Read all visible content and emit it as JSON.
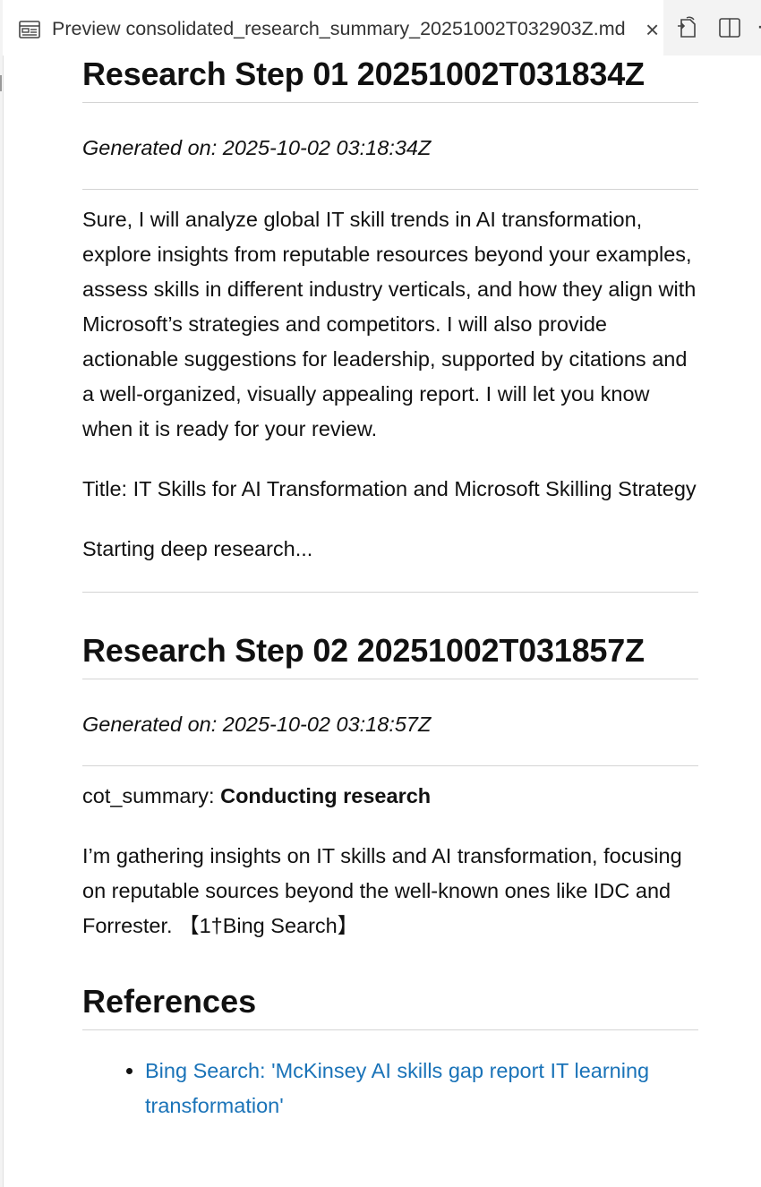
{
  "tab": {
    "title": "Preview consolidated_research_summary_20251002T032903Z.md",
    "close_glyph": "×",
    "more_glyph": "·",
    "icons": [
      "preview-icon",
      "close-icon",
      "open-source-icon",
      "split-editor-icon",
      "more-actions-icon"
    ]
  },
  "steps": [
    {
      "heading": "Research Step 01 20251002T031834Z",
      "generated": "Generated on: 2025-10-02 03:18:34Z",
      "paragraph1": "Sure, I will analyze global IT skill trends in AI transformation, explore insights from reputable resources beyond your examples, assess skills in different industry verticals, and how they align with Microsoft’s strategies and competitors. I will also provide actionable suggestions for leadership, supported by citations and a well-organized, visually appealing report. I will let you know when it is ready for your review.",
      "paragraph2": "Title: IT Skills for AI Transformation and Microsoft Skilling Strategy",
      "paragraph3": "Starting deep research..."
    },
    {
      "heading": "Research Step 02 20251002T031857Z",
      "generated": "Generated on: 2025-10-02 03:18:57Z",
      "cot_label": "cot_summary: ",
      "cot_value": "Conducting research",
      "paragraph1": "I’m gathering insights on IT skills and AI transformation, focusing on reputable sources beyond the well-known ones like IDC and Forrester. 【1†Bing Search】"
    }
  ],
  "references": {
    "heading": "References",
    "items": [
      "Bing Search: 'McKinsey AI skills gap report IT learning transformation'"
    ]
  },
  "colors": {
    "link": "#1a73b8",
    "text": "#111111",
    "toolbar_bg": "#f3f3f3",
    "divider": "#d4d4d4"
  }
}
